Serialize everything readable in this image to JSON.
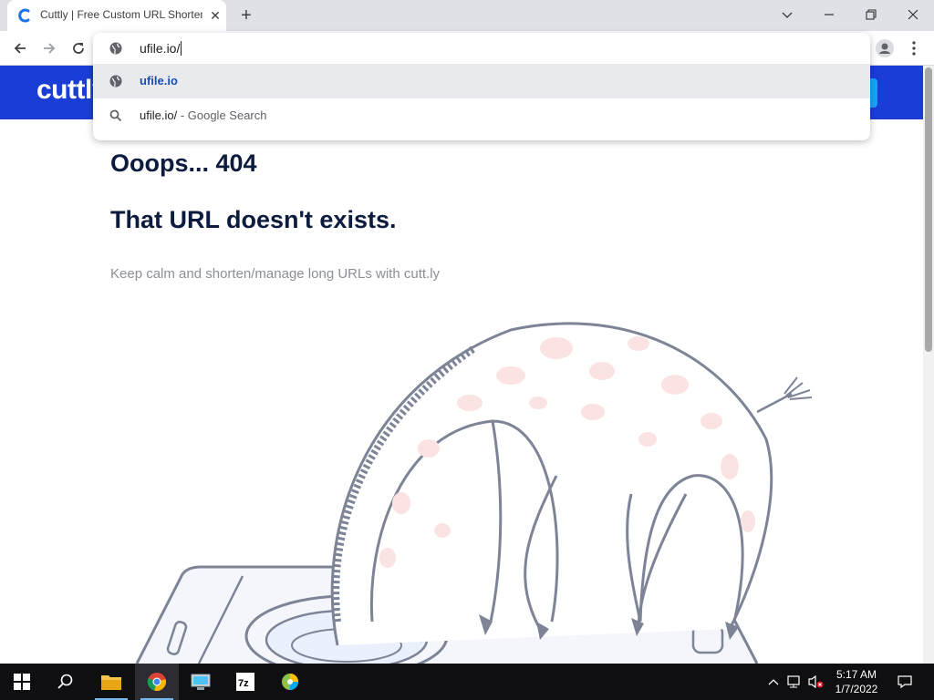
{
  "browser": {
    "tab": {
      "title": "Cuttly | Free Custom URL Shortener"
    },
    "omnibox": {
      "input_value": "ufile.io/",
      "suggestions": [
        {
          "text": "ufile.io",
          "icon": "globe-icon",
          "type": "url"
        },
        {
          "text": "ufile.io/",
          "suffix": " - Google Search",
          "icon": "search-icon",
          "type": "search"
        }
      ]
    }
  },
  "page": {
    "logo": "cuttly",
    "heading1": "Ooops... 404",
    "heading2": "That URL doesn't exists.",
    "subtitle": "Keep calm and shorten/manage long URLs with cutt.ly"
  },
  "taskbar": {
    "clock_time": "5:17 AM",
    "clock_date": "1/7/2022",
    "apps": [
      "file-explorer-icon",
      "chrome-icon",
      "control-panel-icon",
      "7zip-icon",
      "app-icon"
    ]
  },
  "colors": {
    "brand_blue": "#1a3dd6",
    "heading": "#0d1b3e",
    "link_blue": "#1a4fae"
  }
}
